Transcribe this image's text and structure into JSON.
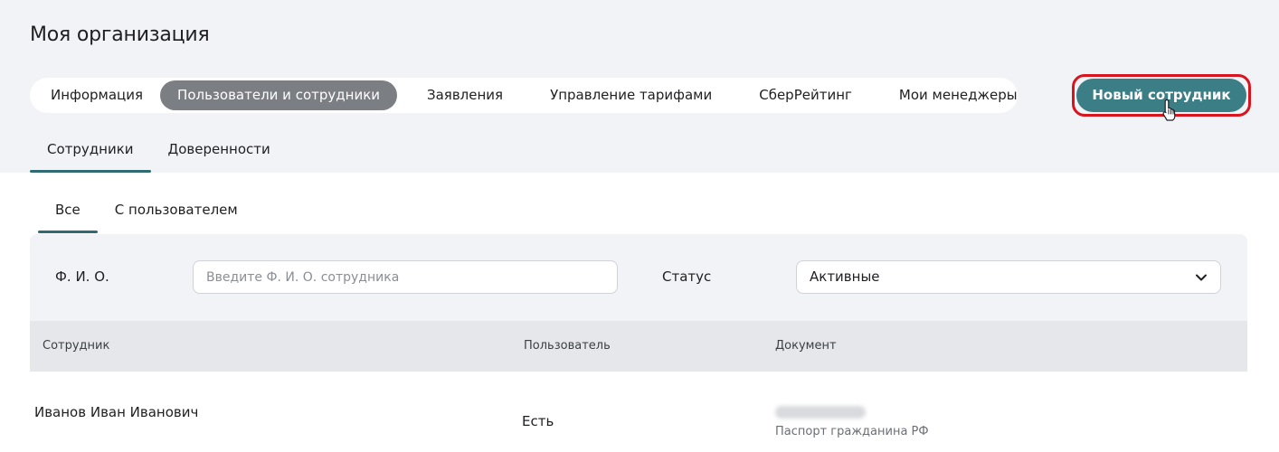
{
  "page_title": "Моя организация",
  "main_tabs": [
    {
      "label": "Информация",
      "active": false
    },
    {
      "label": "Пользователи и сотрудники",
      "active": true
    },
    {
      "label": "Заявления",
      "active": false
    },
    {
      "label": "Управление тарифами",
      "active": false
    },
    {
      "label": "СберРейтинг",
      "active": false
    },
    {
      "label": "Мои менеджеры",
      "active": false
    }
  ],
  "new_employee_button": "Новый сотрудник",
  "sub_tabs": [
    {
      "label": "Сотрудники",
      "active": true
    },
    {
      "label": "Доверенности",
      "active": false
    }
  ],
  "inner_tabs": [
    {
      "label": "Все",
      "active": true
    },
    {
      "label": "С пользователем",
      "active": false
    }
  ],
  "filters": {
    "name_label": "Ф. И. О.",
    "name_placeholder": "Введите Ф. И. О. сотрудника",
    "name_value": "",
    "status_label": "Статус",
    "status_value": "Активные"
  },
  "table": {
    "headers": [
      "Сотрудник",
      "Пользователь",
      "Документ"
    ],
    "rows": [
      {
        "employee": "Иванов Иван Иванович",
        "user": "Есть",
        "document_type": "Паспорт гражданина РФ"
      }
    ]
  },
  "colors": {
    "accent": "#3c7e86",
    "active_tab_pill": "#7b7e83",
    "highlight": "#d8141e"
  }
}
